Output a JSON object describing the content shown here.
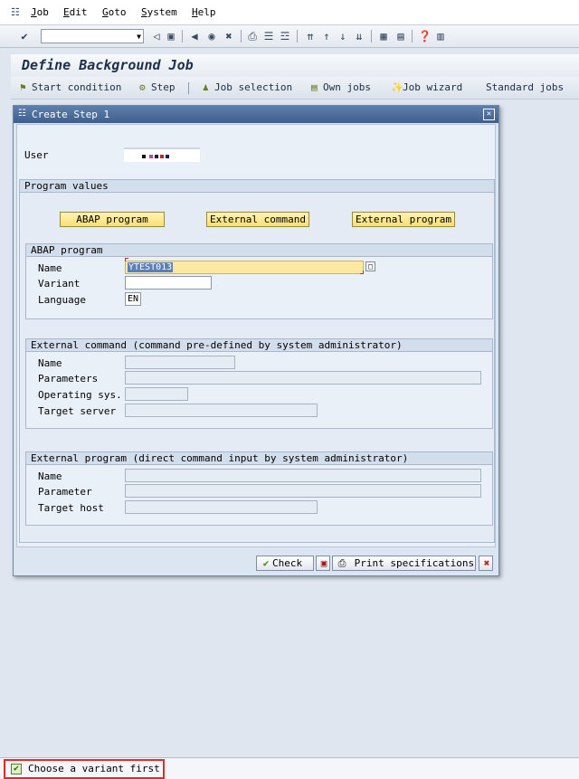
{
  "menu": {
    "items": [
      "Job",
      "Edit",
      "Goto",
      "System",
      "Help"
    ],
    "mnemonics": [
      "J",
      "E",
      "G",
      "S",
      "H"
    ]
  },
  "std_toolbar": {
    "command_field_value": ""
  },
  "screen": {
    "title": "Define Background Job"
  },
  "app_toolbar": {
    "start_condition": "Start condition",
    "step": "Step",
    "job_selection": "Job selection",
    "own_jobs": "Own jobs",
    "job_wizard": "Job wizard",
    "standard_jobs": "Standard jobs"
  },
  "dialog": {
    "title": "Create Step  1",
    "user_label": "User",
    "program_values_label": "Program values",
    "buttons": {
      "abap_program": "ABAP program",
      "external_command": "External command",
      "external_program": "External program"
    },
    "abap_group": {
      "title": "ABAP program",
      "name_label": "Name",
      "name_value": "YTEST013",
      "variant_label": "Variant",
      "variant_value": "",
      "language_label": "Language",
      "language_value": "EN"
    },
    "ext_cmd_group": {
      "title": "External command (command pre-defined by system administrator)",
      "name_label": "Name",
      "parameters_label": "Parameters",
      "operating_sys_label": "Operating sys.",
      "target_server_label": "Target server"
    },
    "ext_prog_group": {
      "title": "External program (direct command input by system administrator)",
      "name_label": "Name",
      "parameter_label": "Parameter",
      "target_host_label": "Target host"
    },
    "footer": {
      "check": "Check",
      "print_specifications": "Print specifications"
    }
  },
  "status": {
    "message": "Choose a variant first"
  },
  "colors": {
    "status_highlight": "#e12b2b",
    "button_yellow": "#f9df70",
    "dialog_title": "#4a6a97"
  }
}
